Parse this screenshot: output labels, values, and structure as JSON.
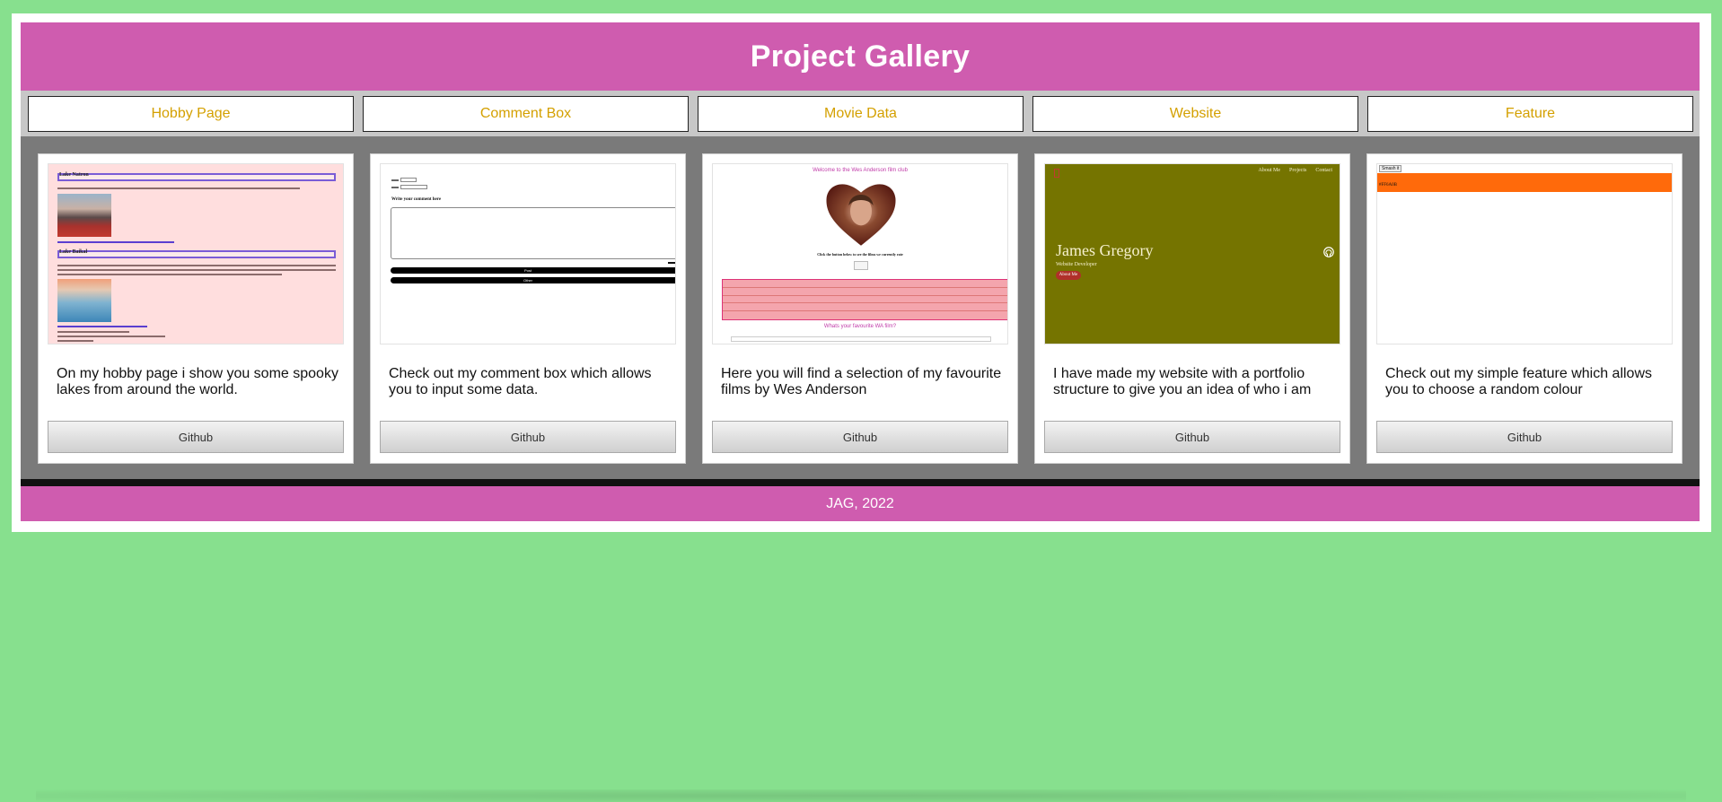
{
  "header": {
    "title": "Project Gallery"
  },
  "nav": {
    "items": [
      {
        "label": "Hobby Page"
      },
      {
        "label": "Comment Box"
      },
      {
        "label": "Movie Data"
      },
      {
        "label": "Website"
      },
      {
        "label": "Feature"
      }
    ]
  },
  "cards": [
    {
      "description": "On my hobby page i show you some spooky lakes from around the world.",
      "button": "Github",
      "thumb": {
        "title_1": "Lake Natron",
        "title_2": "Lake Baikal"
      }
    },
    {
      "description": "Check out my comment box which allows you to input some data.",
      "button": "Github",
      "thumb": {
        "prompt": "Write your comment here",
        "submit": "Post",
        "other": "Other"
      }
    },
    {
      "description": "Here you will find a selection of my favourite films by Wes Anderson",
      "button": "Github",
      "thumb": {
        "title": "Welcome to the Wes Anderson film club",
        "caption": "Click the button below to see the films we currently rate",
        "subtitle": "Whats your favourite WA film?"
      }
    },
    {
      "description": "I have made my website with a portfolio structure to give you an idea of who i am",
      "button": "Github",
      "thumb": {
        "name": "James Gregory",
        "role": "Website Developer",
        "cta": "About Me",
        "nav": [
          "About Me",
          "Projects",
          "Contact"
        ]
      }
    },
    {
      "description": "Check out my simple feature which allows you to choose a random colour",
      "button": "Github",
      "thumb": {
        "button": "Smash it",
        "hex": "#FF6A0B"
      }
    }
  ],
  "footer": {
    "text": "JAG, 2022"
  },
  "colors": {
    "background": "#87e08e",
    "accent": "#cf5caf",
    "nav_text": "#d4a000",
    "gallery_bg": "#7a7a7a",
    "website_bg": "#757400",
    "feature_color": "#ff6a0b"
  }
}
